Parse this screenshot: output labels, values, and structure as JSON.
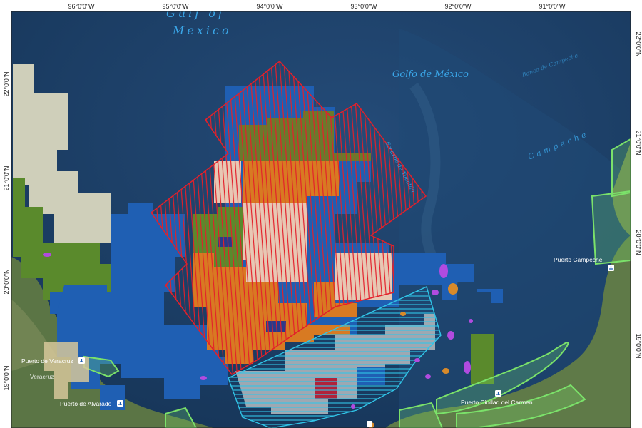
{
  "map": {
    "longitude_ticks": [
      "96°0'0\"W",
      "95°0'0\"W",
      "94°0'0\"W",
      "93°0'0\"W",
      "92°0'0\"W",
      "91°0'0\"W"
    ],
    "latitude_ticks": [
      "22°0'0\"N",
      "21°0'0\"N",
      "20°0'0\"N",
      "19°0'0\"N"
    ],
    "sea_labels": {
      "gulf_en_line1": "Gulf of",
      "gulf_en_line2": "Mexico",
      "gulf_es": "Golfo de México",
      "campeche": "Campeche",
      "campeche_bank": "Banco de Campeche",
      "escarpment": "Escarpe de Yucatán"
    },
    "places": {
      "veracruz": "Puerto de Veracruz",
      "veracruz_small": "Veracruz",
      "alvarado": "Puerto de Alvarado",
      "campeche": "Puerto Campeche",
      "carmen": "Puerto Ciudad del Carmen"
    },
    "icons": [
      "port-icon"
    ],
    "colors": {
      "sea": "#1b3f66",
      "land": "#5b7545",
      "block_blue": "#1f5fb3",
      "block_green": "#5a8a2c",
      "block_orange": "#d87a22",
      "block_cream": "#e7dcc4",
      "hatch_red": "#e3202a",
      "hatch_cyan": "#30c5e8",
      "protected_green": "#7be26a"
    }
  }
}
